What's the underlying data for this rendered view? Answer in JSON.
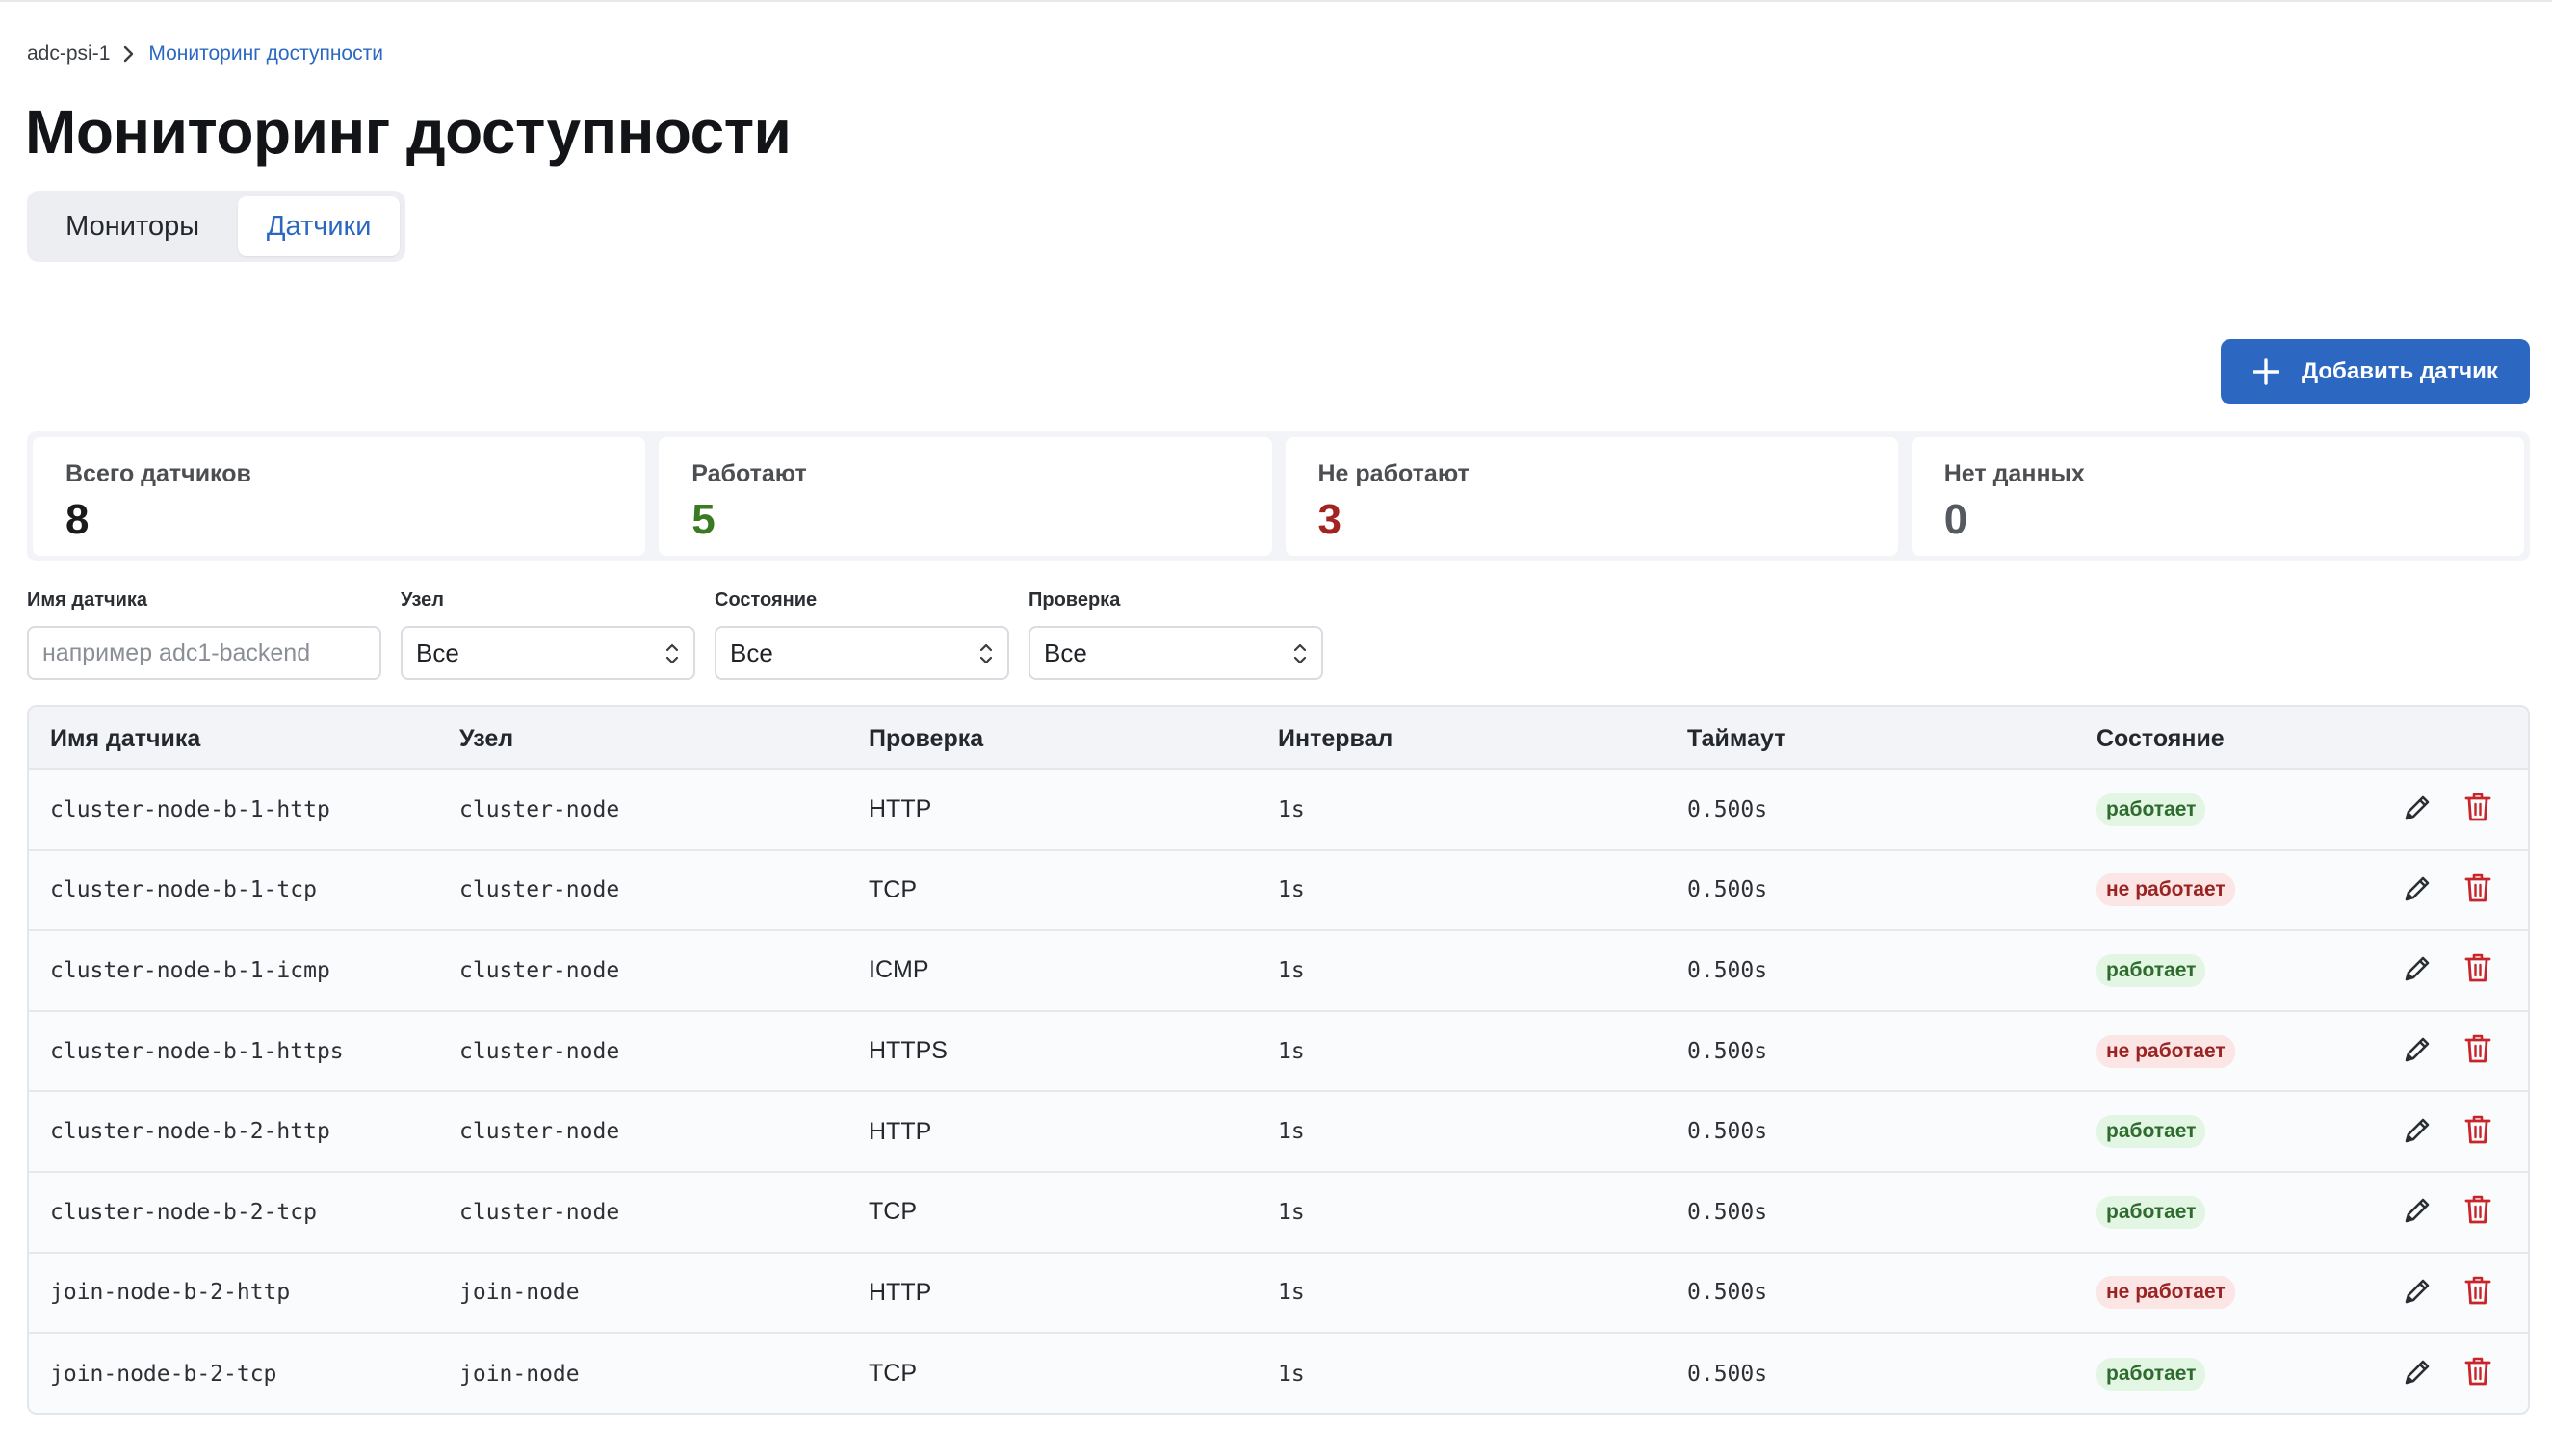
{
  "breadcrumb": {
    "root": "adc-psi-1",
    "current": "Мониторинг доступности"
  },
  "page": {
    "title": "Мониторинг доступности"
  },
  "tabs": [
    {
      "label": "Мониторы",
      "active": false
    },
    {
      "label": "Датчики",
      "active": true
    }
  ],
  "toolbar": {
    "add_label": "Добавить датчик"
  },
  "stats": [
    {
      "label": "Всего датчиков",
      "value": "8",
      "color": "#1a1a1a"
    },
    {
      "label": "Работают",
      "value": "5",
      "color": "#3a7a22"
    },
    {
      "label": "Не работают",
      "value": "3",
      "color": "#a32222"
    },
    {
      "label": "Нет данных",
      "value": "0",
      "color": "#555a61"
    }
  ],
  "filters": {
    "name": {
      "label": "Имя датчика",
      "placeholder": "например adc1-backend"
    },
    "node": {
      "label": "Узел",
      "value": "Все"
    },
    "state": {
      "label": "Состояние",
      "value": "Все"
    },
    "check": {
      "label": "Проверка",
      "value": "Все"
    }
  },
  "table": {
    "columns": [
      "Имя датчика",
      "Узел",
      "Проверка",
      "Интервал",
      "Таймаут",
      "Состояние"
    ],
    "rows": [
      {
        "name": "cluster-node-b-1-http",
        "node": "cluster-node",
        "check": "HTTP",
        "interval": "1s",
        "timeout": "0.500s",
        "state": "работает",
        "ok": true
      },
      {
        "name": "cluster-node-b-1-tcp",
        "node": "cluster-node",
        "check": "TCP",
        "interval": "1s",
        "timeout": "0.500s",
        "state": "не работает",
        "ok": false
      },
      {
        "name": "cluster-node-b-1-icmp",
        "node": "cluster-node",
        "check": "ICMP",
        "interval": "1s",
        "timeout": "0.500s",
        "state": "работает",
        "ok": true
      },
      {
        "name": "cluster-node-b-1-https",
        "node": "cluster-node",
        "check": "HTTPS",
        "interval": "1s",
        "timeout": "0.500s",
        "state": "не работает",
        "ok": false
      },
      {
        "name": "cluster-node-b-2-http",
        "node": "cluster-node",
        "check": "HTTP",
        "interval": "1s",
        "timeout": "0.500s",
        "state": "работает",
        "ok": true
      },
      {
        "name": "cluster-node-b-2-tcp",
        "node": "cluster-node",
        "check": "TCP",
        "interval": "1s",
        "timeout": "0.500s",
        "state": "работает",
        "ok": true
      },
      {
        "name": "join-node-b-2-http",
        "node": "join-node",
        "check": "HTTP",
        "interval": "1s",
        "timeout": "0.500s",
        "state": "не работает",
        "ok": false
      },
      {
        "name": "join-node-b-2-tcp",
        "node": "join-node",
        "check": "TCP",
        "interval": "1s",
        "timeout": "0.500s",
        "state": "работает",
        "ok": true
      }
    ]
  },
  "colors": {
    "accent": "#2c68c2",
    "danger": "#c8252a",
    "ok_badge_bg": "#e3f5e3",
    "bad_badge_bg": "#fbe5e5"
  },
  "icons": {
    "breadcrumb_separator": "chevron-right-icon",
    "add": "plus-icon",
    "select": "chevron-up-down-icon",
    "edit": "pencil-icon",
    "delete": "trash-icon"
  }
}
